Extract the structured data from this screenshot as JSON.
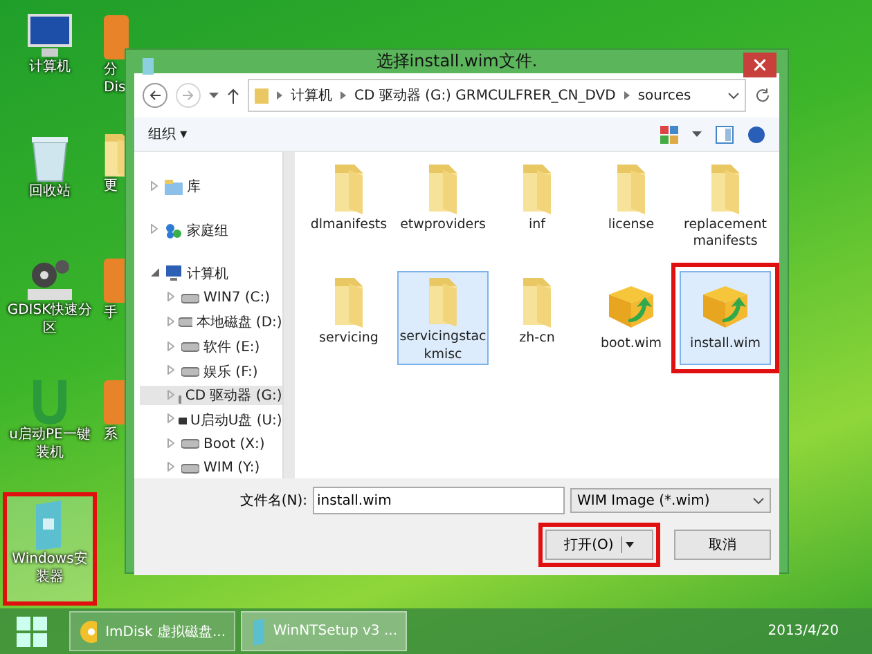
{
  "desktop": {
    "icons": [
      {
        "label": "计算机",
        "kind": "computer",
        "highlighted": false
      },
      {
        "label": "分",
        "label_2": "Dis",
        "kind": "app",
        "highlighted": false
      },
      {
        "label": "回收站",
        "kind": "recycle",
        "highlighted": false
      },
      {
        "label": "更",
        "kind": "folder",
        "highlighted": false
      },
      {
        "label": "GDISK快速分区",
        "kind": "gear",
        "highlighted": false
      },
      {
        "label": "手",
        "kind": "app",
        "highlighted": false
      },
      {
        "label": "u启动PE一键装机",
        "kind": "u",
        "highlighted": false
      },
      {
        "label": "系",
        "kind": "app",
        "highlighted": false
      },
      {
        "label": "Windows安装器",
        "kind": "installer",
        "highlighted": true
      }
    ]
  },
  "dialog": {
    "title": "选择install.wim文件.",
    "breadcrumb": [
      "计算机",
      "CD 驱动器 (G:) GRMCULFRER_CN_DVD",
      "sources"
    ],
    "organize": "组织 ▾",
    "nav": [
      {
        "label": "库",
        "kind": "library",
        "expanded": false,
        "selected": false
      },
      {
        "label": "家庭组",
        "kind": "homegroup",
        "expanded": false,
        "selected": false
      },
      {
        "label": "计算机",
        "kind": "computer",
        "expanded": true,
        "selected": false,
        "children": [
          {
            "label": "WIN7 (C:)",
            "kind": "drive",
            "selected": false
          },
          {
            "label": "本地磁盘 (D:)",
            "kind": "drive",
            "selected": false
          },
          {
            "label": "软件 (E:)",
            "kind": "drive",
            "selected": false
          },
          {
            "label": "娱乐 (F:)",
            "kind": "drive",
            "selected": false
          },
          {
            "label": "CD 驱动器 (G:)",
            "kind": "cd",
            "selected": true
          },
          {
            "label": "U启动U盘 (U:)",
            "kind": "usb",
            "selected": false
          },
          {
            "label": "Boot (X:)",
            "kind": "drive",
            "selected": false
          },
          {
            "label": "WIM (Y:)",
            "kind": "drive",
            "selected": false
          }
        ]
      }
    ],
    "files": [
      {
        "name": "dlmanifests",
        "kind": "folder",
        "selected": false,
        "highlighted": false
      },
      {
        "name": "etwproviders",
        "kind": "folder",
        "selected": false,
        "highlighted": false
      },
      {
        "name": "inf",
        "kind": "folder",
        "selected": false,
        "highlighted": false
      },
      {
        "name": "license",
        "kind": "folder",
        "selected": false,
        "highlighted": false
      },
      {
        "name": "replacementmanifests",
        "kind": "folder",
        "selected": false,
        "highlighted": false
      },
      {
        "name": "servicing",
        "kind": "folder",
        "selected": false,
        "highlighted": false
      },
      {
        "name": "servicingstackmisc",
        "kind": "folder",
        "selected": true,
        "highlighted": false
      },
      {
        "name": "zh-cn",
        "kind": "folder",
        "selected": false,
        "highlighted": false
      },
      {
        "name": "boot.wim",
        "kind": "wim",
        "selected": false,
        "highlighted": false
      },
      {
        "name": "install.wim",
        "kind": "wim",
        "selected": true,
        "highlighted": true
      }
    ],
    "filename_label": "文件名(N):",
    "filename": "install.wim",
    "filter": "WIM Image (*.wim)",
    "open_button": {
      "label": "打开(O)",
      "highlighted": true
    },
    "cancel_button": "取消"
  },
  "taskbar": {
    "items": [
      {
        "label": "ImDisk 虚拟磁盘...",
        "kind": "disc",
        "selected": false
      },
      {
        "label": "WinNTSetup v3 ...",
        "kind": "installer",
        "selected": true
      }
    ],
    "date": "2013/4/20"
  }
}
